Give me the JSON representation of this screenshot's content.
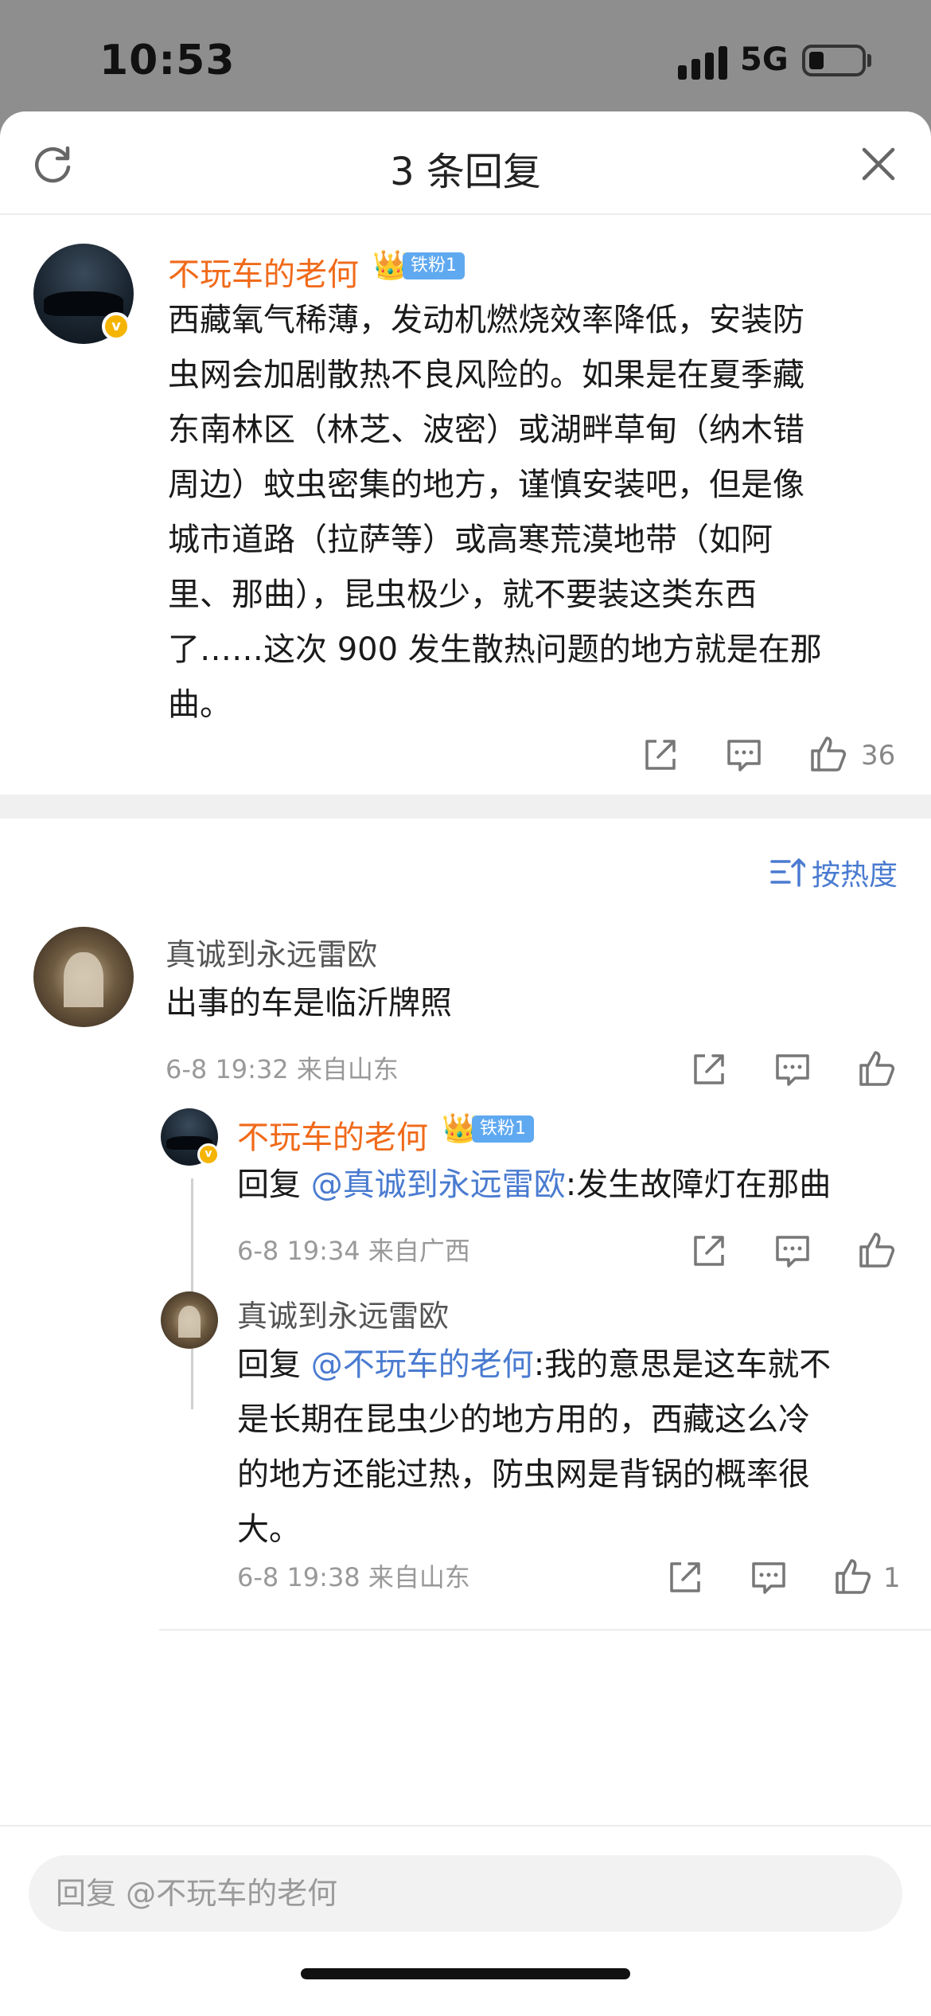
{
  "status": {
    "time": "10:53",
    "network": "5G"
  },
  "header": {
    "title": "3 条回复"
  },
  "main_comment": {
    "username": "不玩车的老何",
    "fan_badge": "铁粉1",
    "lines": [
      "西藏氧气稀薄，发动机燃烧效率降低，安装防",
      "虫网会加剧散热不良风险的。如果是在夏季藏",
      "东南林区（林芝、波密）或湖畔草甸（纳木错",
      "周边）蚊虫密集的地方，谨慎安装吧，但是像",
      "城市道路（拉萨等）或高寒荒漠地带（如阿",
      "里、那曲），昆虫极少，就不要装这类东西",
      "了……这次 900 发生散热问题的地方就是在那",
      "曲。"
    ],
    "likes": "36"
  },
  "sort_label": "按热度",
  "replies": [
    {
      "username": "真诚到永远雷欧",
      "text": "出事的车是临沂牌照",
      "meta": "6-8 19:32  来自山东"
    },
    {
      "username": "不玩车的老何",
      "fan_badge": "铁粉1",
      "reply_prefix": "回复 ",
      "mention": "@真诚到永远雷欧",
      "text": ":发生故障灯在那曲",
      "meta": "6-8 19:34  来自广西"
    },
    {
      "username": "真诚到永远雷欧",
      "reply_prefix": "回复 ",
      "mention": "@不玩车的老何",
      "first_line": ":我的意思是这车就不",
      "lines": [
        "是长期在昆虫少的地方用的，西藏这么冷",
        "的地方还能过热，防虫网是背锅的概率很",
        "大。"
      ],
      "meta": "6-8 19:38  来自山东",
      "likes": "1"
    }
  ],
  "input": {
    "placeholder": "回复 @不玩车的老何"
  },
  "colors": {
    "username": "#f06a1a",
    "link": "#4a7bd0",
    "badge": "#5fa9f0",
    "vip": "#f5b400"
  },
  "icons": [
    "refresh-icon",
    "close-icon",
    "share-icon",
    "comment-icon",
    "like-icon",
    "sort-icon",
    "crown-icon",
    "verified-icon"
  ]
}
